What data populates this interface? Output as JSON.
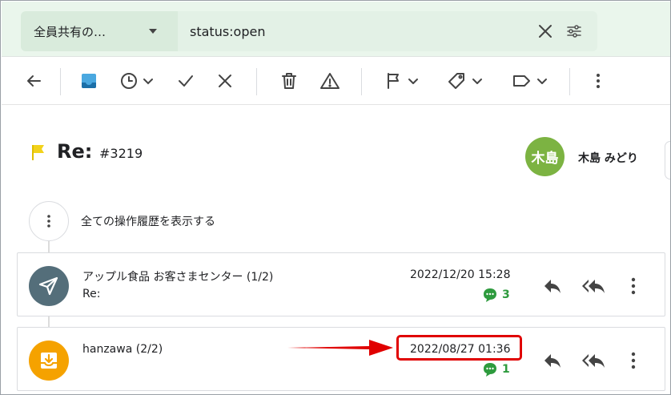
{
  "search": {
    "scope_label": "全員共有の…",
    "query": "status:open"
  },
  "toolbar": {
    "icons": [
      "back-arrow-icon",
      "inbox-icon",
      "snooze-clock-icon",
      "check-icon",
      "close-icon",
      "trash-icon",
      "warning-icon",
      "flag-icon",
      "tag-icon",
      "label-icon",
      "more-vert-icon"
    ]
  },
  "ticket": {
    "subject": "Re:",
    "number": "#3219",
    "flag_color": "#f2d21b",
    "assignee_initials": "木島",
    "assignee_name": "木島 みどり",
    "avatar_color": "#7cb342"
  },
  "timeline": {
    "history_label": "全ての操作履歴を表示する",
    "messages": [
      {
        "sender": "アップル食品 お客さまセンター (1/2)",
        "subject": "Re:",
        "date": "2022/12/20 15:28",
        "comments": "3",
        "avatar_color": "#546e7a",
        "icon": "send-icon"
      },
      {
        "sender": "hanzawa (2/2)",
        "subject": "",
        "date": "2022/08/27 01:36",
        "comments": "1",
        "avatar_color": "#f5a200",
        "icon": "inbox-download-icon"
      }
    ]
  },
  "colors": {
    "accent_green": "#2e9b3e",
    "highlight_red": "#e00000",
    "search_bg": "#eaf6ec"
  }
}
